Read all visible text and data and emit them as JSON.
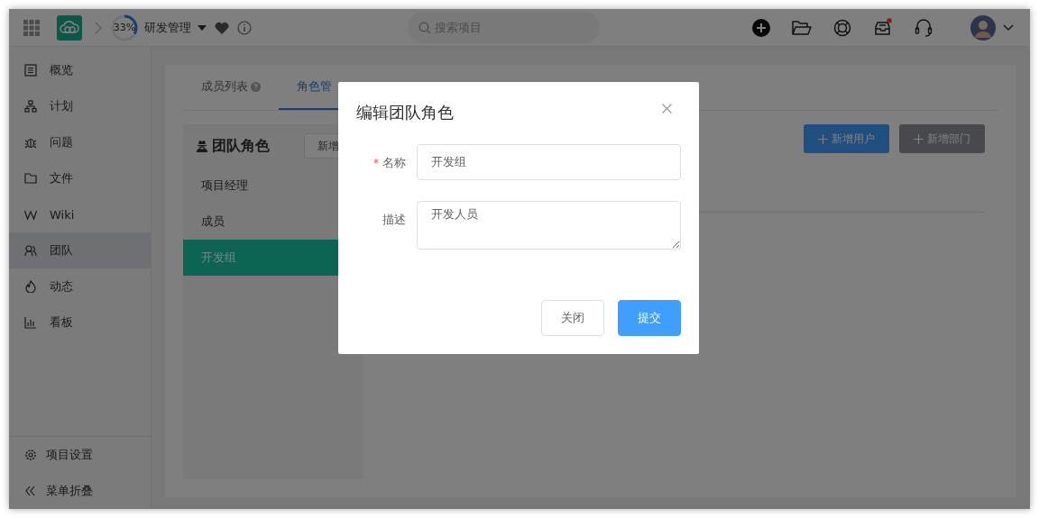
{
  "topbar": {
    "progress": {
      "level": 0.33,
      "label": "33%"
    },
    "project_name": "研发管理",
    "search": {
      "placeholder": "搜索项目"
    },
    "inbox": {
      "unread": true
    }
  },
  "sidebar": {
    "items": [
      {
        "label": "概览",
        "selected": false
      },
      {
        "label": "计划",
        "selected": false
      },
      {
        "label": "问题",
        "selected": false
      },
      {
        "label": "文件",
        "selected": false
      },
      {
        "label": "Wiki",
        "selected": false
      },
      {
        "label": "团队",
        "selected": true
      },
      {
        "label": "动态",
        "selected": false
      },
      {
        "label": "看板",
        "selected": false
      }
    ],
    "bottom": [
      "项目设置",
      "菜单折叠"
    ]
  },
  "tabs": [
    {
      "label": "成员列表",
      "selected": false,
      "help": true
    },
    {
      "label": "角色管",
      "selected": true,
      "help": false
    }
  ],
  "roles_panel": {
    "title": "团队角色",
    "add_button": "新增",
    "roles": [
      {
        "label": "项目经理",
        "selected": false
      },
      {
        "label": "成员",
        "selected": false
      },
      {
        "label": "开发组",
        "selected": true
      }
    ]
  },
  "actions": [
    {
      "label": "新增用户",
      "kind": "primary"
    },
    {
      "label": "新增部门",
      "kind": "info"
    }
  ],
  "dialog": {
    "title": "编辑团队角色",
    "fields": [
      {
        "label": "名称",
        "required": true,
        "kind": "input",
        "value": "开发组"
      },
      {
        "label": "描述",
        "required": false,
        "kind": "textarea",
        "value": "开发人员"
      }
    ],
    "buttons": [
      {
        "label": "关闭",
        "kind": "default"
      },
      {
        "label": "提交",
        "kind": "primary"
      }
    ]
  }
}
